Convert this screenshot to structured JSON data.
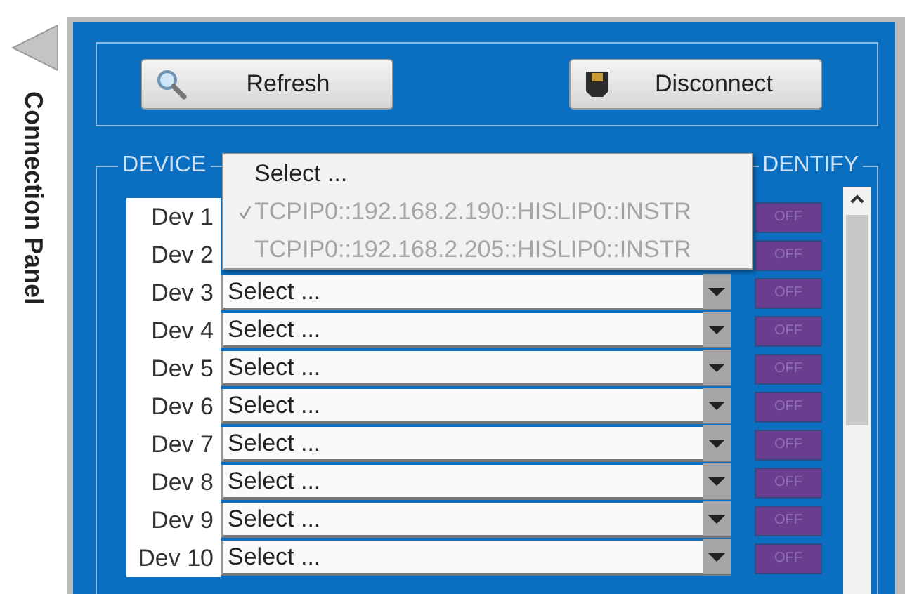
{
  "side_panel": {
    "title": "Connection Panel"
  },
  "buttons": [
    {
      "label": "Refresh",
      "kind": "search"
    },
    {
      "label": "Disconnect",
      "kind": "plug"
    }
  ],
  "device_group": {
    "title": "DEVICE",
    "identify_title": "DENTIFY"
  },
  "devices": [
    {
      "label": "Dev 1",
      "identify": "OFF",
      "on": false
    },
    {
      "label": "Dev 2",
      "identify": "OFF",
      "on": false
    },
    {
      "label": "Dev 3",
      "value": "Select ...",
      "identify": "OFF",
      "on": false
    },
    {
      "label": "Dev 4",
      "value": "Select ...",
      "identify": "OFF",
      "on": false
    },
    {
      "label": "Dev 5",
      "value": "Select ...",
      "identify": "OFF",
      "on": false
    },
    {
      "label": "Dev 6",
      "value": "Select ...",
      "identify": "OFF",
      "on": false
    },
    {
      "label": "Dev 7",
      "value": "Select ...",
      "identify": "OFF",
      "on": false
    },
    {
      "label": "Dev 8",
      "value": "Select ...",
      "identify": "OFF",
      "on": false
    },
    {
      "label": "Dev 9",
      "value": "Select ...",
      "identify": "OFF",
      "on": false
    },
    {
      "label": "Dev 10",
      "value": "Select ...",
      "identify": "OFF",
      "on": false
    }
  ],
  "dropdown_menu": [
    {
      "label": "Select ...",
      "selected": false,
      "disabled": false
    },
    {
      "label": "TCPIP0::192.168.2.190::HISLIP0::INSTR",
      "selected": true,
      "disabled": true
    },
    {
      "label": "TCPIP0::192.168.2.205::HISLIP0::INSTR",
      "selected": false,
      "disabled": true
    }
  ]
}
